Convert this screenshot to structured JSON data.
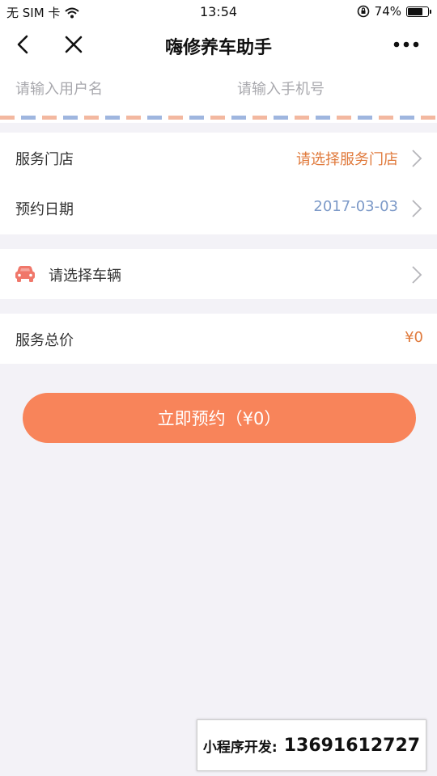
{
  "status_bar": {
    "carrier": "无 SIM 卡",
    "time": "13:54",
    "battery": "74%",
    "battery_level": 0.74
  },
  "nav": {
    "title": "嗨修养车助手"
  },
  "user": {
    "name_placeholder": "请输入用户名",
    "phone_placeholder": "请输入手机号"
  },
  "service": {
    "store_label": "服务门店",
    "store_value": "请选择服务门店",
    "date_label": "预约日期",
    "date_value": "2017-03-03"
  },
  "vehicle": {
    "label": "请选择车辆"
  },
  "price": {
    "label": "服务总价",
    "value": "¥0"
  },
  "book_button": {
    "label": "立即预约（¥0）"
  },
  "watermark": {
    "label": "小程序开发:",
    "phone": "13691612727"
  },
  "colors": {
    "accent": "#f8845a",
    "store_value": "#e07a3c",
    "date_value": "#7d9ac8",
    "price_value": "#e07a3c",
    "car_icon": "#f0776a",
    "background": "#f3f2f7"
  }
}
